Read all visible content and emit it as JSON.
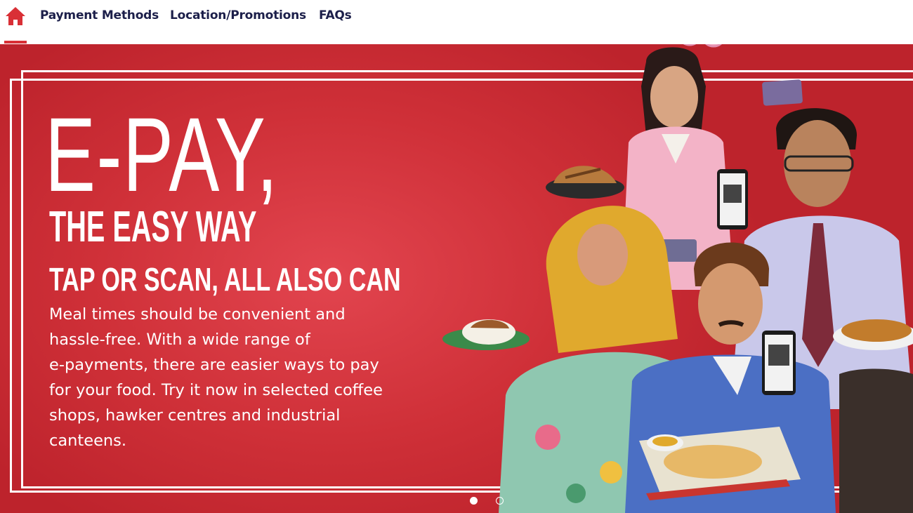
{
  "nav": {
    "home_icon": "home-icon",
    "links": [
      "Payment Methods",
      "Location/Promotions",
      "FAQs"
    ]
  },
  "hero": {
    "title_big": "E-PAY,",
    "title_mid": "THE EASY WAY",
    "subtitle": "TAP OR SCAN, ALL ALSO CAN",
    "body_lines": [
      "Meal times should be convenient and",
      "hassle-free. With a wide range of",
      "e-payments, there are easier ways to pay",
      "for your food. Try it now in selected coffee",
      "shops, hawker centres and industrial",
      "canteens."
    ]
  },
  "carousel": {
    "slides": 2,
    "active": 1
  },
  "colors": {
    "brand_red": "#d93036",
    "nav_text": "#1c1f4a",
    "hero_red": "#cf3038",
    "white": "#ffffff"
  }
}
